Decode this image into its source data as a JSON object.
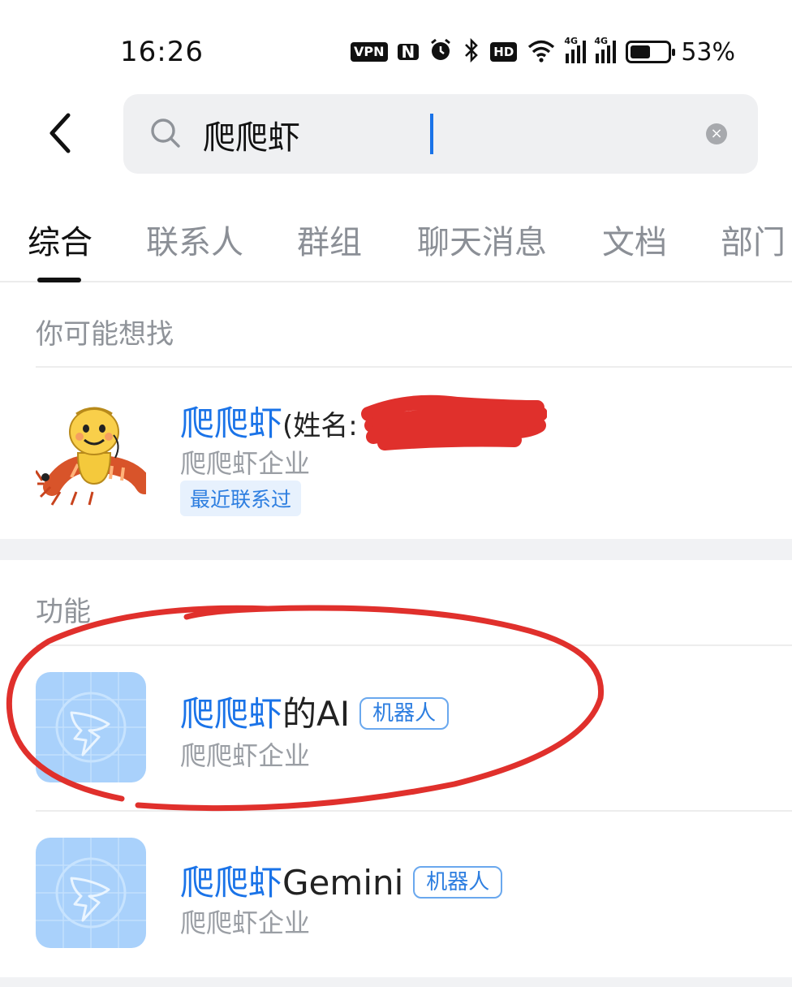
{
  "status_bar": {
    "time": "16:26",
    "vpn": "VPN",
    "hd": "HD",
    "net_4g_1": "4G",
    "net_4g_2": "4G",
    "battery_level": 0.53,
    "battery_pct": "53%"
  },
  "search": {
    "query": "爬爬虾",
    "clear_glyph": "×"
  },
  "tabs": [
    "综合",
    "联系人",
    "群组",
    "聊天消息",
    "文档",
    "部门"
  ],
  "active_tab": 0,
  "sections": {
    "suggest_title": "你可能想找",
    "function_title": "功能"
  },
  "contact_result": {
    "name_highlight": "爬爬虾",
    "name_rest": "(姓名:",
    "org": "爬爬虾企业",
    "badge": "最近联系过"
  },
  "function_results": [
    {
      "name_highlight": "爬爬虾",
      "name_rest": "的AI",
      "badge": "机器人",
      "org": "爬爬虾企业"
    },
    {
      "name_highlight": "爬爬虾",
      "name_rest": "Gemini",
      "badge": "机器人",
      "org": "爬爬虾企业"
    }
  ],
  "colors": {
    "accent": "#1a73e8",
    "annotation_red": "#e0302c",
    "app_icon_bg": "#a9d1fb"
  }
}
